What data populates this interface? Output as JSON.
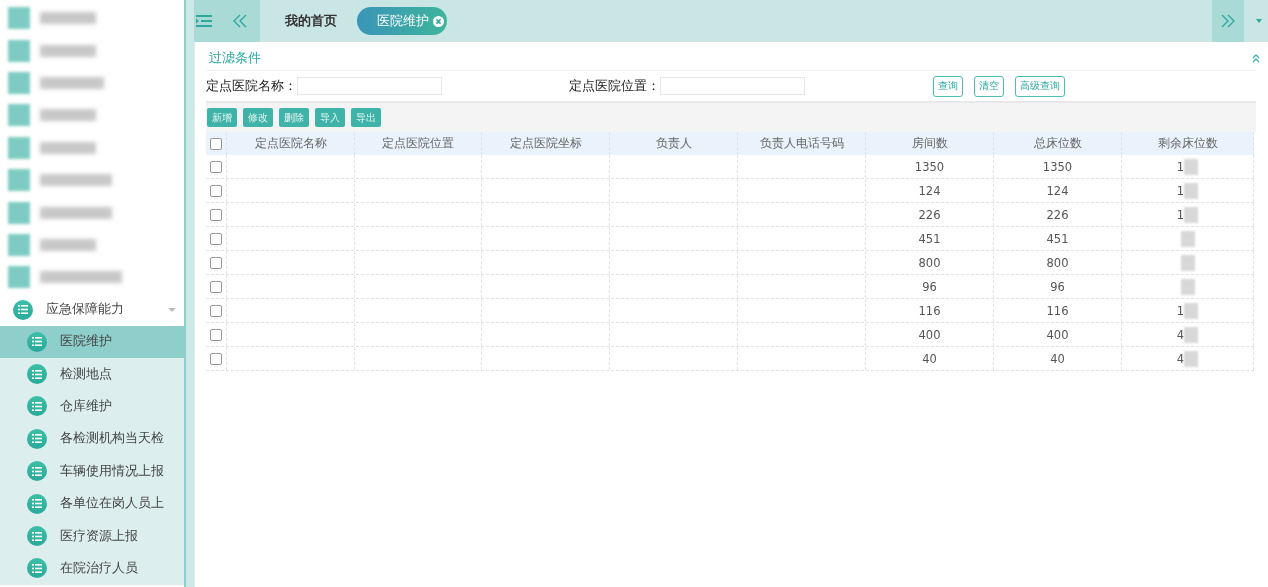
{
  "sidebar": {
    "blurred_items": [
      {
        "kind": "redacted"
      },
      {
        "kind": "redacted"
      },
      {
        "kind": "redacted"
      },
      {
        "kind": "redacted"
      },
      {
        "kind": "redacted"
      },
      {
        "kind": "redacted"
      },
      {
        "kind": "redacted"
      },
      {
        "kind": "redacted"
      },
      {
        "kind": "redacted"
      }
    ],
    "group": {
      "label": "应急保障能力",
      "expanded": true,
      "children": [
        {
          "label": "医院维护",
          "selected": true
        },
        {
          "label": "检测地点",
          "selected": false
        },
        {
          "label": "仓库维护",
          "selected": false
        },
        {
          "label": "各检测机构当天检",
          "selected": false
        },
        {
          "label": "车辆使用情况上报",
          "selected": false
        },
        {
          "label": "各单位在岗人员上",
          "selected": false
        },
        {
          "label": "医疗资源上报",
          "selected": false
        },
        {
          "label": "在院治疗人员",
          "selected": false
        }
      ]
    }
  },
  "tabs": [
    {
      "label": "我的首页",
      "selected": false,
      "closable": false
    },
    {
      "label": "医院维护",
      "selected": true,
      "closable": true
    }
  ],
  "filter": {
    "title": "过滤条件",
    "fields": [
      {
        "label": "定点医院名称："
      },
      {
        "label": "定点医院位置："
      }
    ],
    "buttons": [
      "查询",
      "清空",
      "高级查询"
    ]
  },
  "toolbar": [
    "新增",
    "修改",
    "删除",
    "导入",
    "导出"
  ],
  "table": {
    "select_all_checked": false,
    "columns": [
      "定点医院名称",
      "定点医院位置",
      "定点医院坐标",
      "负责人",
      "负责人电话号码",
      "房间数",
      "总床位数",
      "剩余床位数"
    ],
    "rows": [
      {
        "checked": false,
        "rooms": "1350",
        "beds": "1350",
        "remaining": "1",
        "redacted": true
      },
      {
        "checked": false,
        "rooms": "124",
        "beds": "124",
        "remaining": "1",
        "redacted": true
      },
      {
        "checked": false,
        "rooms": "226",
        "beds": "226",
        "remaining": "1",
        "redacted": true
      },
      {
        "checked": false,
        "rooms": "451",
        "beds": "451",
        "redacted": true
      },
      {
        "checked": false,
        "rooms": "800",
        "beds": "800",
        "redacted": true
      },
      {
        "checked": false,
        "rooms": "96",
        "beds": "96",
        "redacted": true
      },
      {
        "checked": false,
        "rooms": "116",
        "beds": "116",
        "remaining": "1",
        "redacted": true
      },
      {
        "checked": false,
        "rooms": "400",
        "beds": "400",
        "remaining": "4",
        "redacted": true
      },
      {
        "checked": false,
        "rooms": "40",
        "beds": "40",
        "remaining": "4",
        "redacted": true
      }
    ]
  }
}
